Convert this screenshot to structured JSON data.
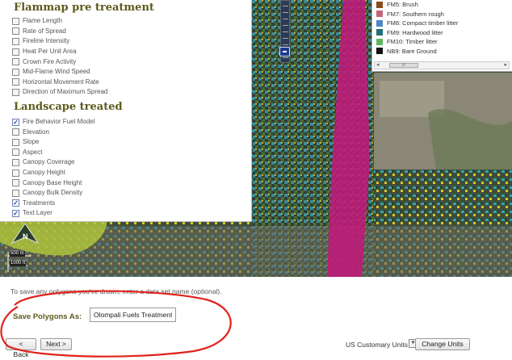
{
  "left_panel": {
    "flammap_title": "Flammap pre treatment",
    "flammap_options": [
      {
        "label": "Flame Length",
        "checked": false
      },
      {
        "label": "Rate of Spread",
        "checked": false
      },
      {
        "label": "Fireline Intensity",
        "checked": false
      },
      {
        "label": "Heat Per Unit Area",
        "checked": false
      },
      {
        "label": "Crown Fire Activity",
        "checked": false
      },
      {
        "label": "Mid-Flame Wind Speed",
        "checked": false
      },
      {
        "label": "Horizontal Movement Rate",
        "checked": false
      },
      {
        "label": "Direction of Maximum Spread",
        "checked": false
      }
    ],
    "landscape_title": "Landscape treated",
    "landscape_options": [
      {
        "label": "Fire Behavior Fuel Model",
        "checked": true
      },
      {
        "label": "Elevation",
        "checked": false
      },
      {
        "label": "Slope",
        "checked": false
      },
      {
        "label": "Aspect",
        "checked": false
      },
      {
        "label": "Canopy Coverage",
        "checked": false
      },
      {
        "label": "Canopy Height",
        "checked": false
      },
      {
        "label": "Canopy Base Height",
        "checked": false
      },
      {
        "label": "Canopy Bulk Density",
        "checked": false
      },
      {
        "label": "Treatments",
        "checked": true
      },
      {
        "label": "Text Layer",
        "checked": true
      }
    ]
  },
  "legend": {
    "items": [
      {
        "label": "FM5: Brush",
        "color": "#8b4a1e"
      },
      {
        "label": "FM7: Southern rough",
        "color": "#c4677a"
      },
      {
        "label": "FM8: Compact timber litter",
        "color": "#4f86c6"
      },
      {
        "label": "FM9: Hardwood litter",
        "color": "#1f6f78"
      },
      {
        "label": "FM10: Timber litter",
        "color": "#5db85d"
      },
      {
        "label": "NB9: Bare Ground",
        "color": "#111111"
      }
    ],
    "scroll_left": "◂",
    "scroll_right": "▸",
    "scroll_thumb": "III"
  },
  "map": {
    "north_label": "N",
    "scale_top": "500 m",
    "scale_bottom": "1000 ft"
  },
  "form": {
    "instructions": "To save any polygons you've drawn, enter a data set name (optional).",
    "save_label": "Save Polygons As:",
    "save_value": "Olompali Fuels Treatment",
    "back_label": "< Back",
    "next_label": "Next >",
    "units_label": "US Customary Units",
    "units_dropdown": "▼",
    "change_units_label": "Change Units",
    "annotation_color": "#e0221b"
  }
}
